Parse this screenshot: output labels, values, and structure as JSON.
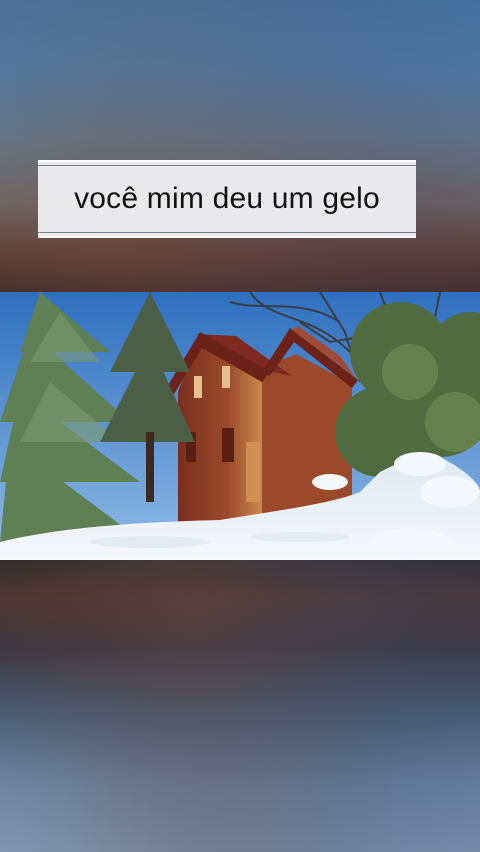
{
  "caption": {
    "text": "você mim deu um gelo"
  },
  "colors": {
    "sky": "#3f7fc4",
    "house": "#8b3a26",
    "snow": "#eef3f8",
    "pine": "#5f7f55"
  }
}
